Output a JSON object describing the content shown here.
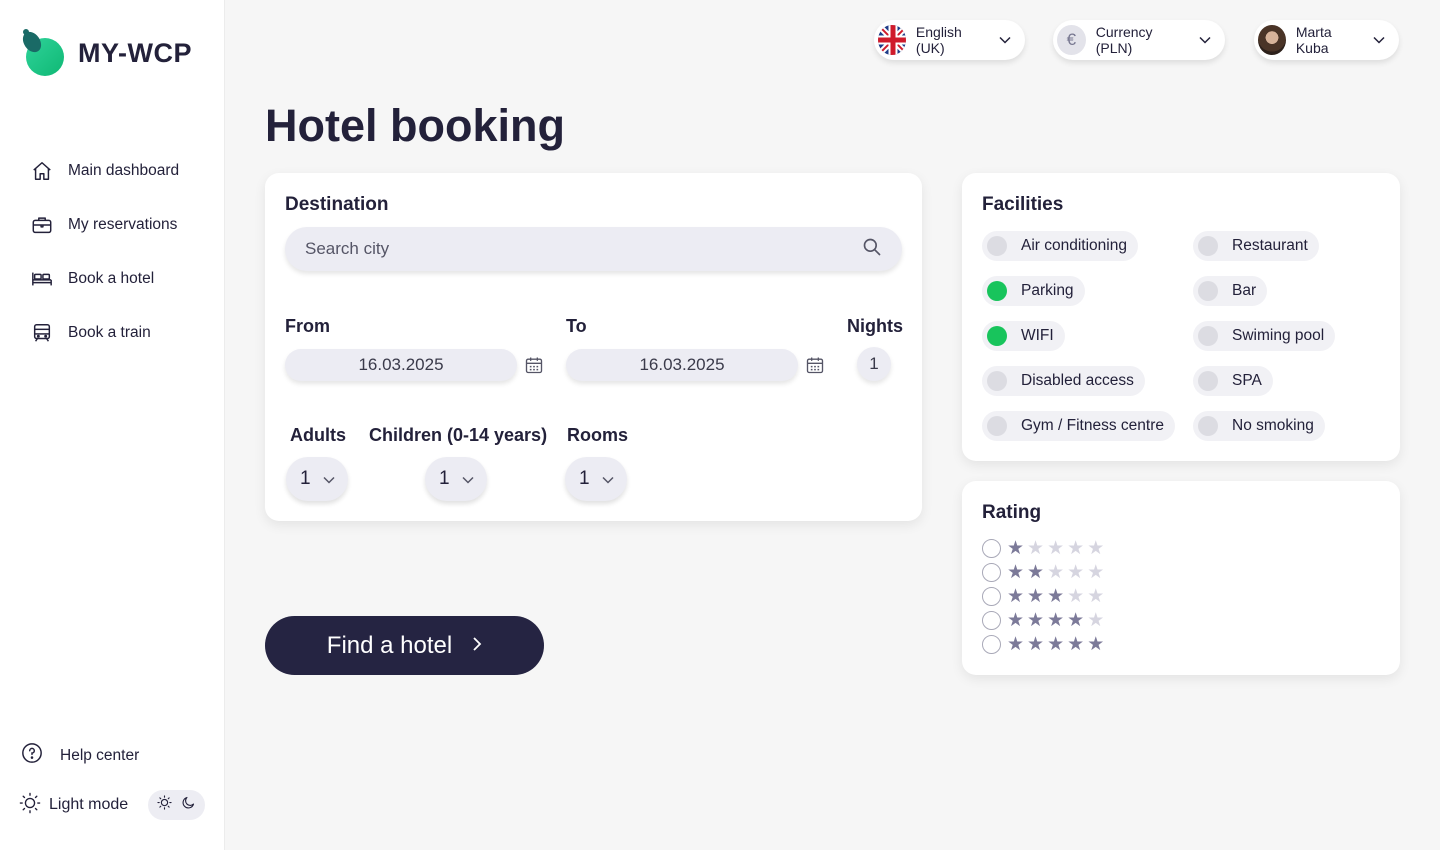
{
  "brand": {
    "name": "MY-WCP"
  },
  "sidebar": {
    "items": [
      {
        "label": "Main dashboard",
        "icon": "home-icon"
      },
      {
        "label": "My reservations",
        "icon": "briefcase-icon"
      },
      {
        "label": "Book a hotel",
        "icon": "bed-icon"
      },
      {
        "label": "Book a train",
        "icon": "train-icon"
      }
    ],
    "help_label": "Help center",
    "mode_label": "Light mode"
  },
  "topbar": {
    "language": "English (UK)",
    "currency": "Currency (PLN)",
    "currency_symbol": "€",
    "user": "Marta Kuba"
  },
  "page": {
    "title": "Hotel booking"
  },
  "booking": {
    "destination_label": "Destination",
    "search_placeholder": "Search city",
    "from_label": "From",
    "from_value": "16.03.2025",
    "to_label": "To",
    "to_value": "16.03.2025",
    "nights_label": "Nights",
    "nights_value": "1",
    "adults_label": "Adults",
    "adults_value": "1",
    "children_label": "Children (0-14 years)",
    "children_value": "1",
    "rooms_label": "Rooms",
    "rooms_value": "1"
  },
  "find_button": {
    "label": "Find a hotel"
  },
  "facilities": {
    "title": "Facilities",
    "items": [
      {
        "label": "Air conditioning",
        "selected": false
      },
      {
        "label": "Restaurant",
        "selected": false
      },
      {
        "label": "Parking",
        "selected": true
      },
      {
        "label": "Bar",
        "selected": false
      },
      {
        "label": "WIFI",
        "selected": true
      },
      {
        "label": "Swiming pool",
        "selected": false
      },
      {
        "label": "Disabled access",
        "selected": false
      },
      {
        "label": "SPA",
        "selected": false
      },
      {
        "label": "Gym / Fitness centre",
        "selected": false
      },
      {
        "label": "No smoking",
        "selected": false
      }
    ]
  },
  "rating": {
    "title": "Rating",
    "options": [
      1,
      2,
      3,
      4,
      5
    ],
    "max_stars": 5
  },
  "colors": {
    "accent_dark": "#252442",
    "selected_green": "#18c45c",
    "star_filled": "#7c7a99",
    "star_empty": "#d6d5e0"
  }
}
